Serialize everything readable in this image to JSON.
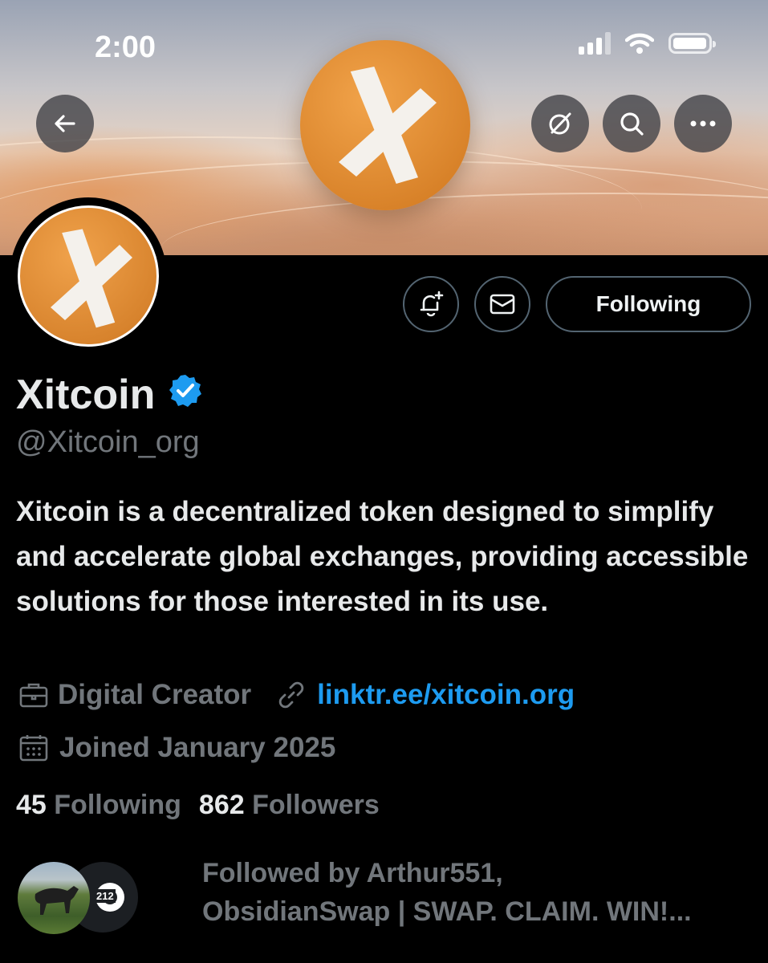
{
  "status_bar": {
    "time": "2:00"
  },
  "profile": {
    "name": "Xitcoin",
    "handle": "@Xitcoin_org",
    "bio": "Xitcoin is a decentralized token designed to simplify and accelerate global exchanges, providing accessible solutions for those interested in its use.",
    "category": "Digital Creator",
    "link": "linktr.ee/xitcoin.org",
    "joined": "Joined January 2025",
    "following_count": "45",
    "following_label": "Following",
    "followers_count": "862",
    "followers_label": "Followers",
    "verified": true
  },
  "actions": {
    "follow_label": "Following"
  },
  "followed_by": {
    "line1": "Followed by Arthur551,",
    "line2": "ObsidianSwap | SWAP. CLAIM. WIN!...",
    "avatar2_badge": "212"
  },
  "icons": {
    "back": "arrow-left-icon",
    "grok": "grok-icon",
    "search": "search-icon",
    "more": "more-icon",
    "notify": "bell-plus-icon",
    "message": "envelope-icon",
    "category": "briefcase-icon",
    "link": "link-icon",
    "joined": "calendar-icon",
    "verified": "verified-badge-icon"
  },
  "colors": {
    "background": "#000000",
    "brand_orange": "#E28A2E",
    "link_blue": "#1D9BF0",
    "verified_blue": "#1D9BF0",
    "muted_text": "#71767B"
  }
}
